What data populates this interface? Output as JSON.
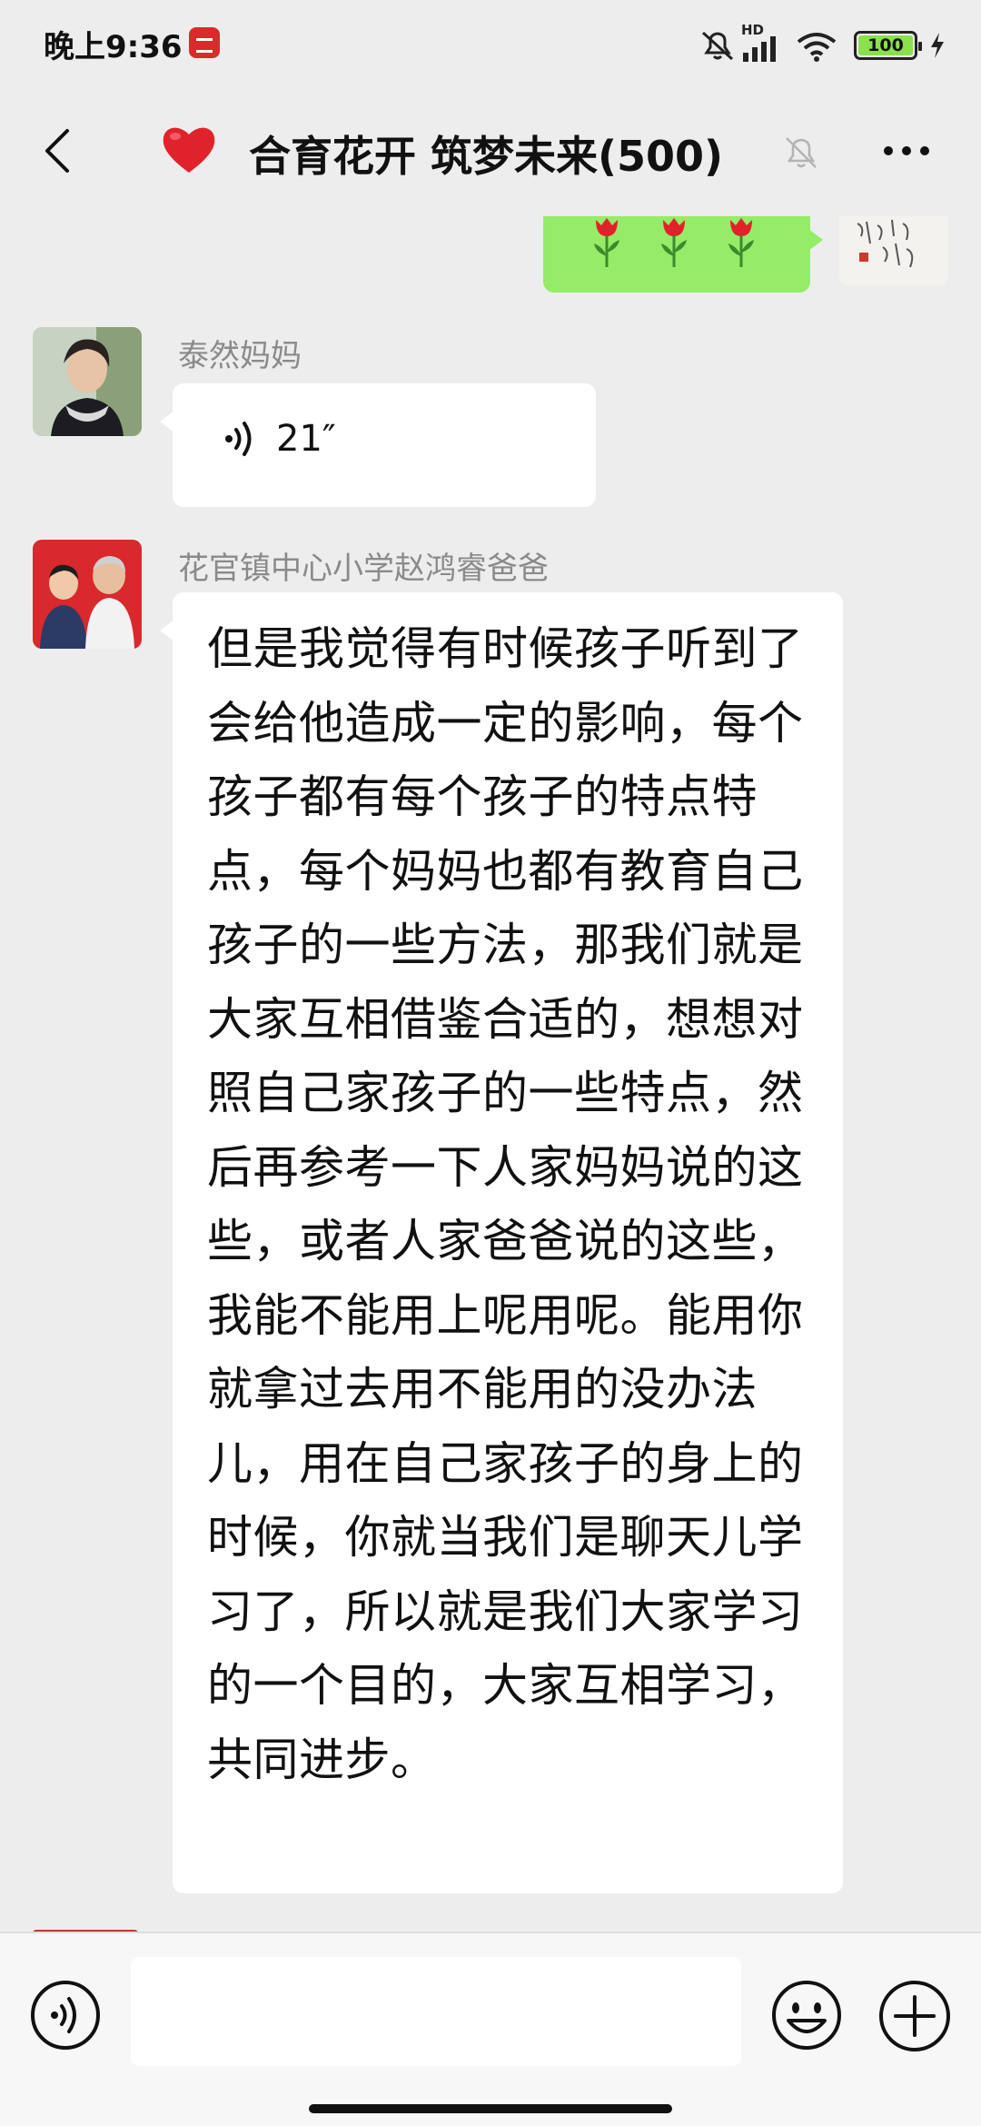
{
  "status_bar": {
    "time": "晚上9:36",
    "network_label": "HD",
    "battery_level": "100",
    "icons": [
      "app-notification-icon",
      "mute-icon",
      "signal-icon",
      "wifi-icon",
      "battery-icon",
      "charging-icon"
    ]
  },
  "header": {
    "title": "合育花开 筑梦未来(500)",
    "title_emoji": "heart",
    "icons": [
      "back-icon",
      "muted-bell-icon",
      "more-icon"
    ]
  },
  "messages": [
    {
      "type": "emoji",
      "sender": "self",
      "content_emoji": [
        "tulip",
        "tulip",
        "tulip"
      ],
      "bubble_color": "#95ec69"
    },
    {
      "type": "voice",
      "sender": "泰然妈妈",
      "duration": "21″"
    },
    {
      "type": "text",
      "sender": "花官镇中心小学赵鸿睿爸爸",
      "text": "但是我觉得有时候孩子听到了会给他造成一定的影响，每个孩子都有每个孩子的特点特点，每个妈妈也都有教育自己孩子的一些方法，那我们就是大家互相借鉴合适的，想想对照自己家孩子的一些特点，然后再参考一下人家妈妈说的这些，或者人家爸爸说的这些，我能不能用上呢用呢。能用你就拿过去用不能用的没办法儿，用在自己家孩子的身上的时候，你就当我们是聊天儿学习了，所以就是我们大家学习的一个目的，大家互相学习，共同进步。"
    }
  ],
  "input_bar": {
    "placeholder": "",
    "icons": [
      "voice-toggle-icon",
      "emoji-icon",
      "plus-icon"
    ]
  },
  "colors": {
    "background": "#ededed",
    "self_bubble": "#95ec69",
    "other_bubble": "#ffffff",
    "sender_name": "#8a8a8a"
  }
}
